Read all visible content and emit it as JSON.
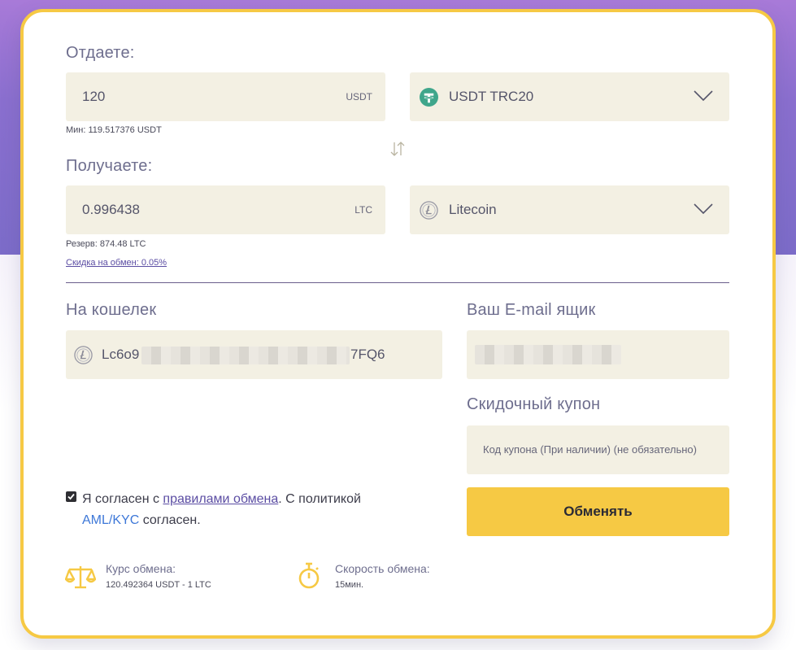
{
  "give": {
    "label": "Отдаете:",
    "amount": "120",
    "unit": "USDT",
    "currency": "USDT TRC20",
    "min_text": "Мин: 119.517376 USDT"
  },
  "receive": {
    "label": "Получаете:",
    "amount": "0.996438",
    "unit": "LTC",
    "currency": "Litecoin",
    "reserve_text": "Резерв: 874.48 LTC",
    "discount_link": "Скидка на обмен: 0.05%"
  },
  "wallet": {
    "label": "На кошелек",
    "value_start": "Lc6o9",
    "value_end": "7FQ6"
  },
  "email": {
    "label": "Ваш E-mail ящик"
  },
  "coupon": {
    "label": "Скидочный купон",
    "placeholder": "Код купона (При наличии) (не обязательно)"
  },
  "agreement": {
    "prefix": "Я согласен с ",
    "rules_link": "правилами обмена",
    "middle": ". С политикой ",
    "aml_link": "AML/KYC",
    "suffix": " согласен."
  },
  "exchange_button": "Обменять",
  "rate": {
    "title": "Курс обмена:",
    "value": "120.492364 USDT - 1 LTC"
  },
  "speed": {
    "title": "Скорость обмена:",
    "value": "15мин."
  },
  "colors": {
    "accent": "#f6c944",
    "field_bg": "#f3f0e3",
    "link": "#5b4da3",
    "aml_link": "#3e78d8",
    "tether": "#3fa68b"
  }
}
